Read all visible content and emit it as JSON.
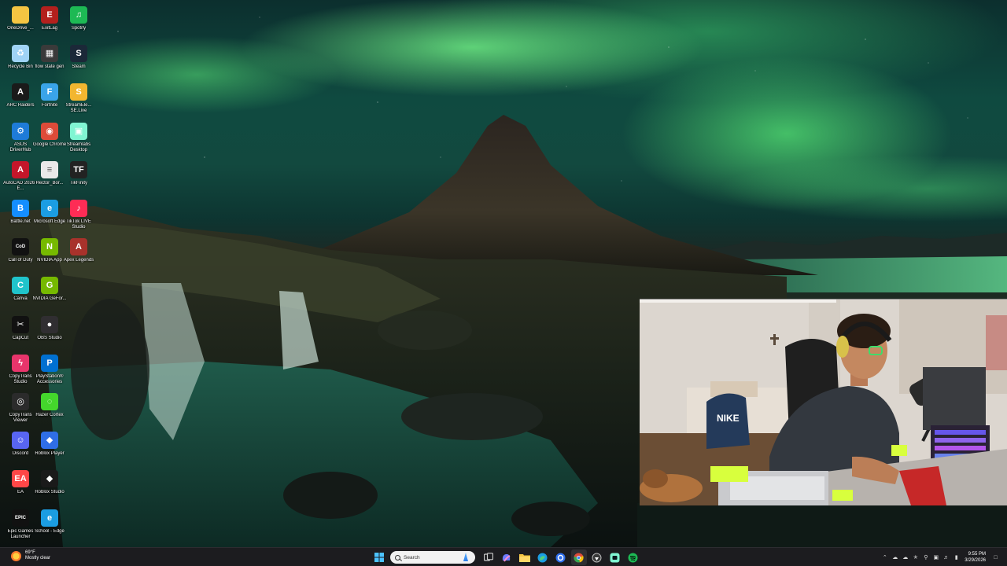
{
  "desktop": {
    "icons": [
      {
        "label": "OneDrive_...",
        "icon": "folder-icon",
        "color": "#f4c542",
        "col": 0,
        "row": 0
      },
      {
        "label": "ExitLag",
        "icon": "exitlag-icon",
        "color": "#b3201d",
        "col": 1,
        "row": 0
      },
      {
        "label": "Spotify",
        "icon": "spotify-icon",
        "color": "#1db954",
        "col": 2,
        "row": 0
      },
      {
        "label": "Recycle Bin",
        "icon": "recycle-bin-icon",
        "color": "#9fd3f5",
        "col": 0,
        "row": 1
      },
      {
        "label": "flow state gen",
        "icon": "file-icon",
        "color": "#3a3a3a",
        "col": 1,
        "row": 1
      },
      {
        "label": "Steam",
        "icon": "steam-icon",
        "color": "#1b2838",
        "col": 2,
        "row": 1
      },
      {
        "label": "ARC Raiders",
        "icon": "arc-raiders-icon",
        "color": "#1a1a1a",
        "col": 0,
        "row": 2
      },
      {
        "label": "Fortnite",
        "icon": "fortnite-icon",
        "color": "#3aa4e8",
        "col": 1,
        "row": 2
      },
      {
        "label": "StreamEle... SE.Live",
        "icon": "streamelements-icon",
        "color": "#f2b630",
        "col": 2,
        "row": 2
      },
      {
        "label": "ASUS DriverHub",
        "icon": "asus-driverhub-icon",
        "color": "#1e7bd8",
        "col": 0,
        "row": 3
      },
      {
        "label": "Google Chrome",
        "icon": "chrome-icon",
        "color": "#dd4b39",
        "col": 1,
        "row": 3
      },
      {
        "label": "Streamlabs Desktop",
        "icon": "streamlabs-icon",
        "color": "#80f5d2",
        "col": 2,
        "row": 3
      },
      {
        "label": "AutoCAD 2026 - E...",
        "icon": "autocad-icon",
        "color": "#c4162a",
        "col": 0,
        "row": 4
      },
      {
        "label": "Hector_Bor...",
        "icon": "document-icon",
        "color": "#e9e9e9",
        "col": 1,
        "row": 4
      },
      {
        "label": "TikFinity",
        "icon": "tikfinity-icon",
        "color": "#222222",
        "col": 2,
        "row": 4
      },
      {
        "label": "Battle.net",
        "icon": "battlenet-icon",
        "color": "#148eff",
        "col": 0,
        "row": 5
      },
      {
        "label": "Microsoft Edge",
        "icon": "edge-icon",
        "color": "#1b9de2",
        "col": 1,
        "row": 5
      },
      {
        "label": "TikTok LIVE Studio",
        "icon": "tiktok-live-icon",
        "color": "#fe2c55",
        "col": 2,
        "row": 5
      },
      {
        "label": "Call of Duty",
        "icon": "call-of-duty-icon",
        "color": "#111111",
        "col": 0,
        "row": 6
      },
      {
        "label": "NVIDIA App",
        "icon": "nvidia-icon",
        "color": "#76b900",
        "col": 1,
        "row": 6
      },
      {
        "label": "Apex Legends",
        "icon": "apex-legends-icon",
        "color": "#a8322b",
        "col": 2,
        "row": 6
      },
      {
        "label": "Canva",
        "icon": "canva-icon",
        "color": "#20c4cb",
        "col": 0,
        "row": 7
      },
      {
        "label": "NVIDIA GeFor...",
        "icon": "nvidia-geforce-icon",
        "color": "#76b900",
        "col": 1,
        "row": 7
      },
      {
        "label": "CapCut",
        "icon": "capcut-icon",
        "color": "#111111",
        "col": 0,
        "row": 8
      },
      {
        "label": "OBS Studio",
        "icon": "obs-icon",
        "color": "#302e31",
        "col": 1,
        "row": 8
      },
      {
        "label": "CopyTrans Studio",
        "icon": "copytrans-studio-icon",
        "color": "#e8356b",
        "col": 0,
        "row": 9
      },
      {
        "label": "PlayStation® Accessories",
        "icon": "playstation-icon",
        "color": "#0070d1",
        "col": 1,
        "row": 9
      },
      {
        "label": "CopyTrans Viewer",
        "icon": "copytrans-viewer-icon",
        "color": "#2b2b2b",
        "col": 0,
        "row": 10
      },
      {
        "label": "Razer Cortex",
        "icon": "razer-cortex-icon",
        "color": "#44d62c",
        "col": 1,
        "row": 10
      },
      {
        "label": "Discord",
        "icon": "discord-icon",
        "color": "#5865f2",
        "col": 0,
        "row": 11
      },
      {
        "label": "Roblox Player",
        "icon": "roblox-icon",
        "color": "#2f6ee6",
        "col": 1,
        "row": 11
      },
      {
        "label": "EA",
        "icon": "ea-icon",
        "color": "#ff4747",
        "col": 0,
        "row": 12
      },
      {
        "label": "Roblox Studio",
        "icon": "roblox-studio-icon",
        "color": "#1a1a1a",
        "col": 1,
        "row": 12
      },
      {
        "label": "Epic Games Launcher",
        "icon": "epic-games-icon",
        "color": "#111111",
        "col": 0,
        "row": 13
      },
      {
        "label": "School - Edge",
        "icon": "edge-school-icon",
        "color": "#1b9de2",
        "col": 1,
        "row": 13
      }
    ]
  },
  "taskbar": {
    "weather": {
      "temp": "69°F",
      "condition": "Mostly clear"
    },
    "search_placeholder": "Search",
    "apps": [
      {
        "name": "start-button",
        "icon": "windows-logo-icon",
        "color": "#4cc2ff"
      },
      {
        "name": "task-view-button",
        "icon": "task-view-icon",
        "color": "#cccccc"
      },
      {
        "name": "copilot-button",
        "icon": "copilot-icon",
        "color": "#6d7cff"
      },
      {
        "name": "file-explorer-button",
        "icon": "folder-icon",
        "color": "#f4c542"
      },
      {
        "name": "edge-button",
        "icon": "edge-icon",
        "color": "#1b9de2"
      },
      {
        "name": "store-button",
        "icon": "store-icon",
        "color": "#3c9be6"
      },
      {
        "name": "chrome-button",
        "icon": "chrome-icon",
        "color": "#dd4b39"
      },
      {
        "name": "app-button-1",
        "icon": "app-icon",
        "color": "#3a3a3a"
      },
      {
        "name": "streamlabs-button",
        "icon": "streamlabs-icon",
        "color": "#80f5d2"
      },
      {
        "name": "spotify-button",
        "icon": "spotify-icon",
        "color": "#1db954"
      }
    ],
    "clock": {
      "time": "9:55 PM",
      "date": "3/29/2026"
    }
  }
}
